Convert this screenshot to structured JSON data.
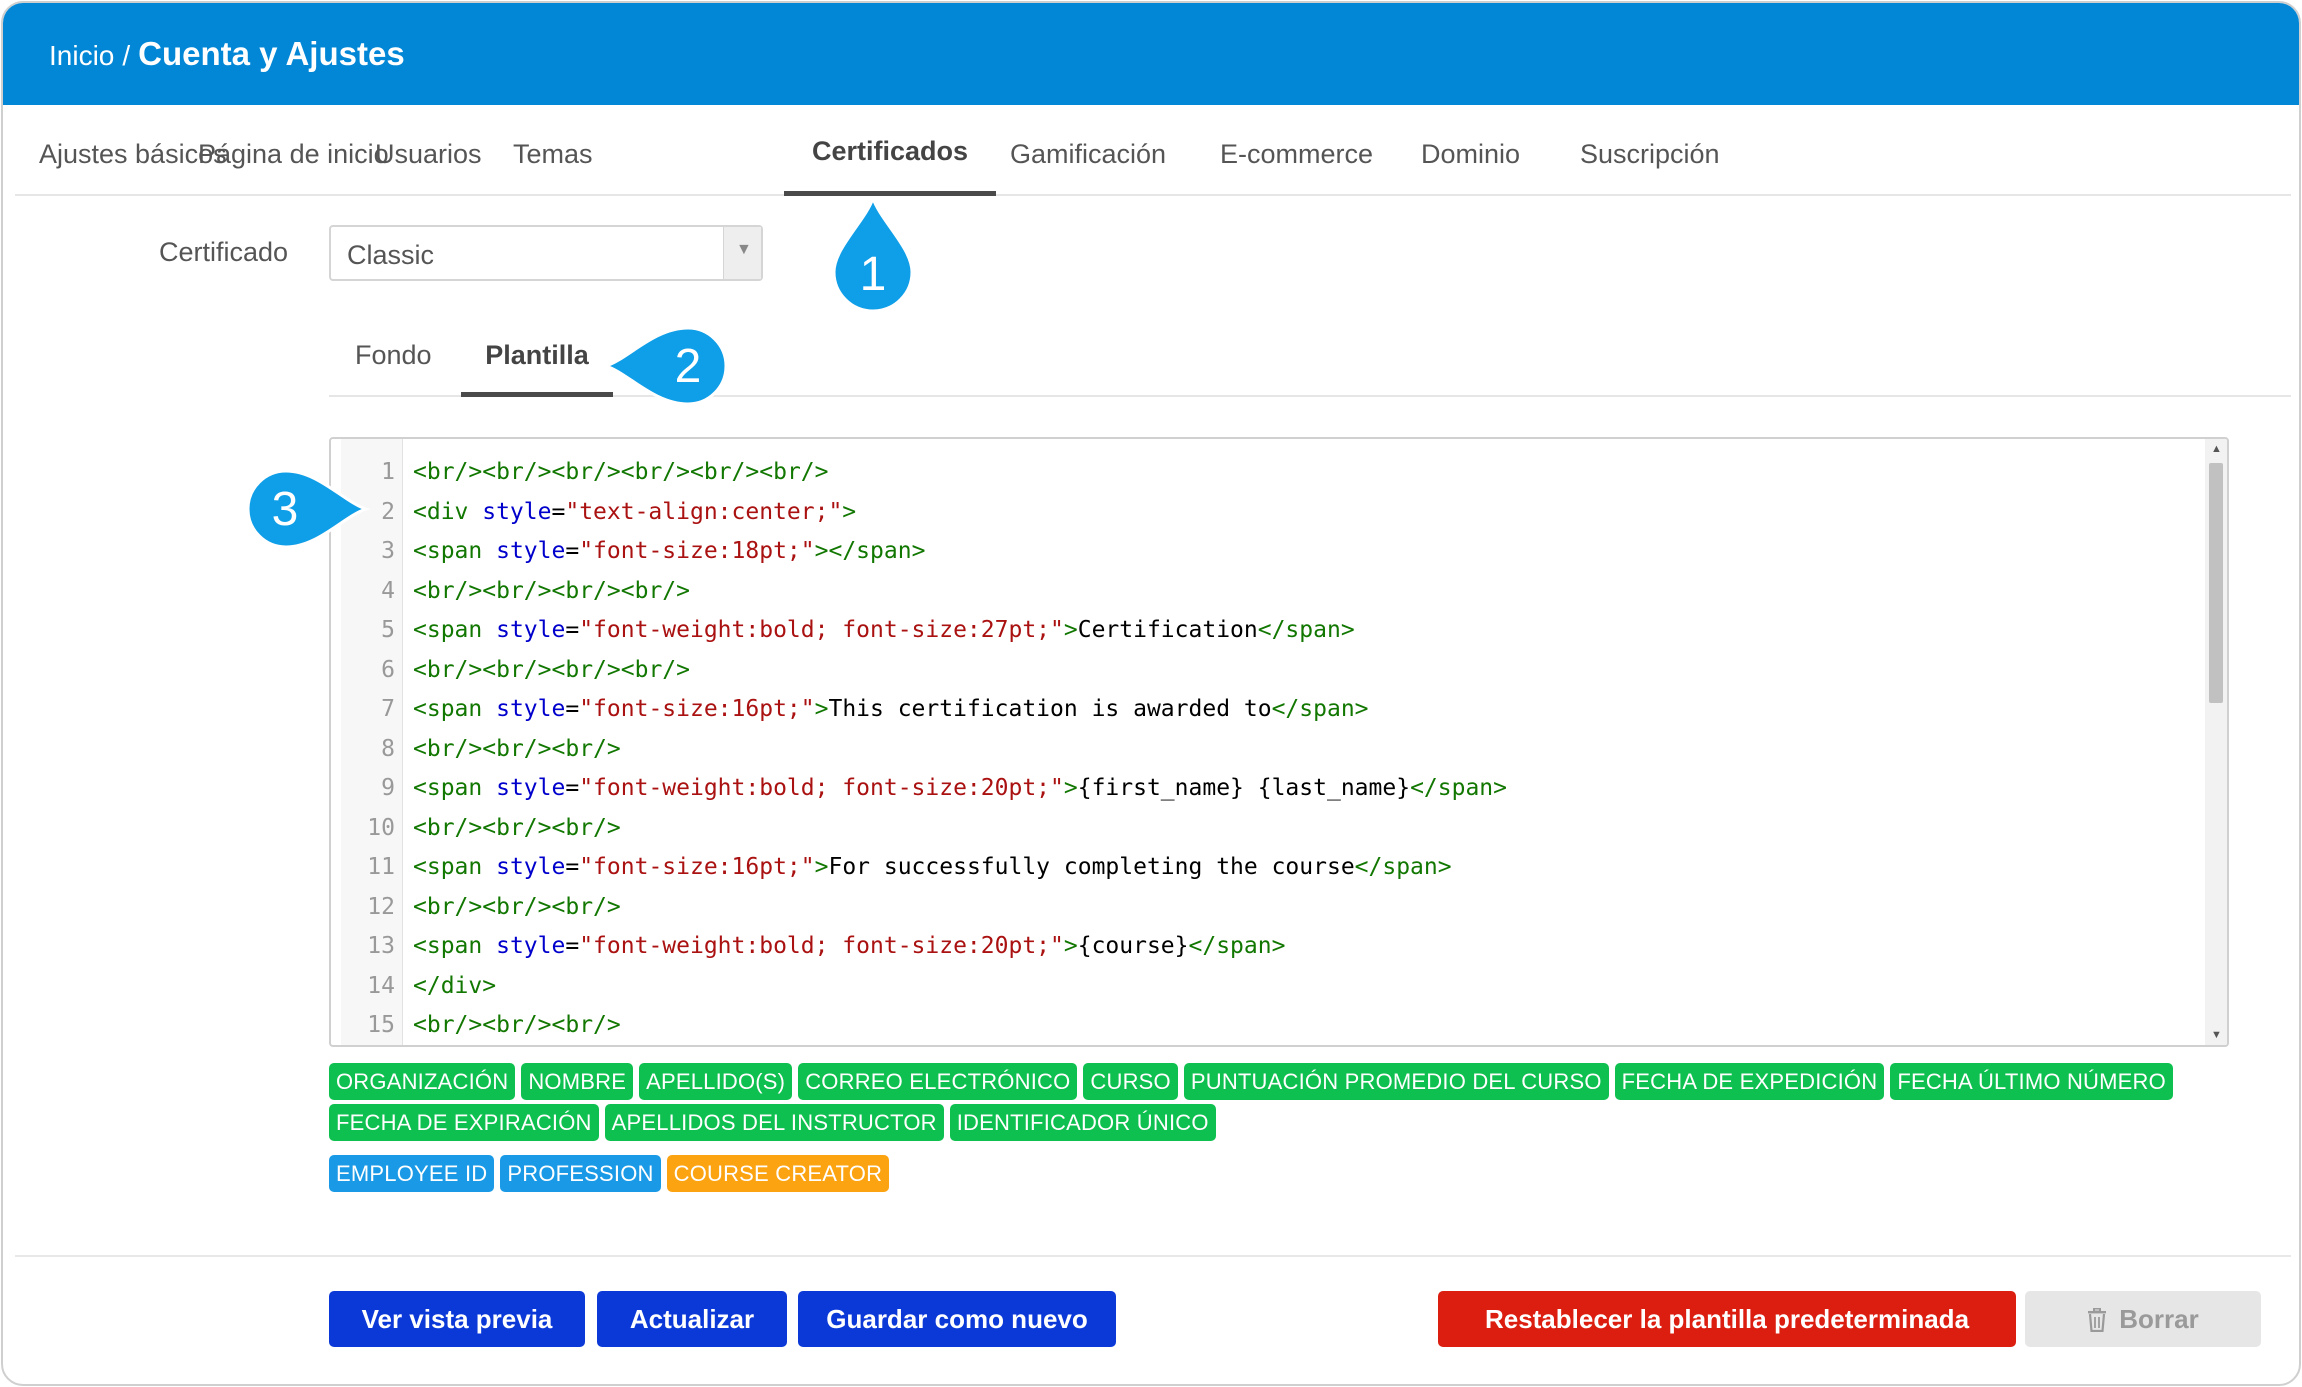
{
  "breadcrumb": {
    "home": "Inicio",
    "separator": "/",
    "current": "Cuenta y Ajustes"
  },
  "tabs": [
    {
      "label": "Ajustes básicos",
      "active": false
    },
    {
      "label": "Página de inicio",
      "active": false
    },
    {
      "label": "Usuarios",
      "active": false
    },
    {
      "label": "Temas",
      "active": false
    },
    {
      "label": "Certificados",
      "active": true
    },
    {
      "label": "Gamificación",
      "active": false
    },
    {
      "label": "E-commerce",
      "active": false
    },
    {
      "label": "Dominio",
      "active": false
    },
    {
      "label": "Suscripción",
      "active": false
    }
  ],
  "certificate": {
    "label": "Certificado",
    "selected": "Classic"
  },
  "subtabs": [
    {
      "label": "Fondo",
      "active": false
    },
    {
      "label": "Plantilla",
      "active": true
    }
  ],
  "editor": {
    "lines": [
      {
        "n": "1",
        "code": "<br/><br/><br/><br/><br/><br/>"
      },
      {
        "n": "2",
        "code": "<div style=\"text-align:center;\">"
      },
      {
        "n": "3",
        "code": "<span style=\"font-size:18pt;\"></span>"
      },
      {
        "n": "4",
        "code": "<br/><br/><br/><br/>"
      },
      {
        "n": "5",
        "code": "<span style=\"font-weight:bold; font-size:27pt;\">Certification</span>"
      },
      {
        "n": "6",
        "code": "<br/><br/><br/><br/>"
      },
      {
        "n": "7",
        "code": "<span style=\"font-size:16pt;\">This certification is awarded to</span>"
      },
      {
        "n": "8",
        "code": "<br/><br/><br/>"
      },
      {
        "n": "9",
        "code": "<span style=\"font-weight:bold; font-size:20pt;\">{first_name} {last_name}</span>"
      },
      {
        "n": "10",
        "code": "<br/><br/><br/>"
      },
      {
        "n": "11",
        "code": "<span style=\"font-size:16pt;\">For successfully completing the course</span>"
      },
      {
        "n": "12",
        "code": "<br/><br/><br/>"
      },
      {
        "n": "13",
        "code": "<span style=\"font-weight:bold; font-size:20pt;\">{course}</span>"
      },
      {
        "n": "14",
        "code": "</div>"
      },
      {
        "n": "15",
        "code": "<br/><br/><br/>"
      }
    ]
  },
  "placeholder_tags": {
    "rows": [
      [
        "ORGANIZACIÓN",
        "NOMBRE",
        "APELLIDO(S)",
        "CORREO ELECTRÓNICO",
        "CURSO",
        "PUNTUACIÓN PROMEDIO DEL CURSO",
        "FECHA DE EXPEDICIÓN",
        "FECHA ÚLTIMO NÚMERO"
      ],
      [
        "FECHA DE EXPIRACIÓN",
        "APELLIDOS DEL INSTRUCTOR",
        "IDENTIFICADOR ÚNICO"
      ]
    ],
    "custom": [
      {
        "label": "EMPLOYEE ID",
        "color": "blue"
      },
      {
        "label": "PROFESSION",
        "color": "blue"
      },
      {
        "label": "COURSE CREATOR",
        "color": "orange"
      }
    ]
  },
  "buttons": {
    "preview": "Ver vista previa",
    "update": "Actualizar",
    "save_new": "Guardar como nuevo",
    "reset": "Restablecer la plantilla predeterminada",
    "delete": "Borrar"
  },
  "callouts": [
    "1",
    "2",
    "3"
  ],
  "colors": {
    "topbar": "#0287d7",
    "callout": "#0f9ee8",
    "primary_button": "#0b39d8",
    "danger_button": "#db1e10",
    "tag_green": "#0ec04f",
    "tag_blue": "#1a9ae6",
    "tag_orange": "#fca311"
  }
}
